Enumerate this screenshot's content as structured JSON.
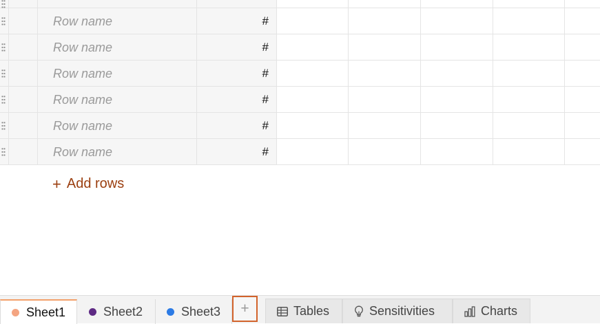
{
  "grid": {
    "row_name_placeholder": "Row name",
    "unit_symbol": "#",
    "add_rows": {
      "icon": "plus-icon",
      "label": "Add rows"
    }
  },
  "sheets": [
    {
      "label": "Sheet1",
      "color": "#f4a582",
      "active": true
    },
    {
      "label": "Sheet2",
      "color": "#5e2a84",
      "active": false
    },
    {
      "label": "Sheet3",
      "color": "#2c7be5",
      "active": false
    }
  ],
  "add_sheet_label": "+",
  "views": [
    {
      "label": "Tables",
      "icon": "table-icon"
    },
    {
      "label": "Sensitivities",
      "icon": "lightbulb-icon"
    },
    {
      "label": "Charts",
      "icon": "bar-chart-icon"
    }
  ],
  "colors": {
    "accent": "#9b3f10",
    "highlight_border": "#d2632b"
  }
}
